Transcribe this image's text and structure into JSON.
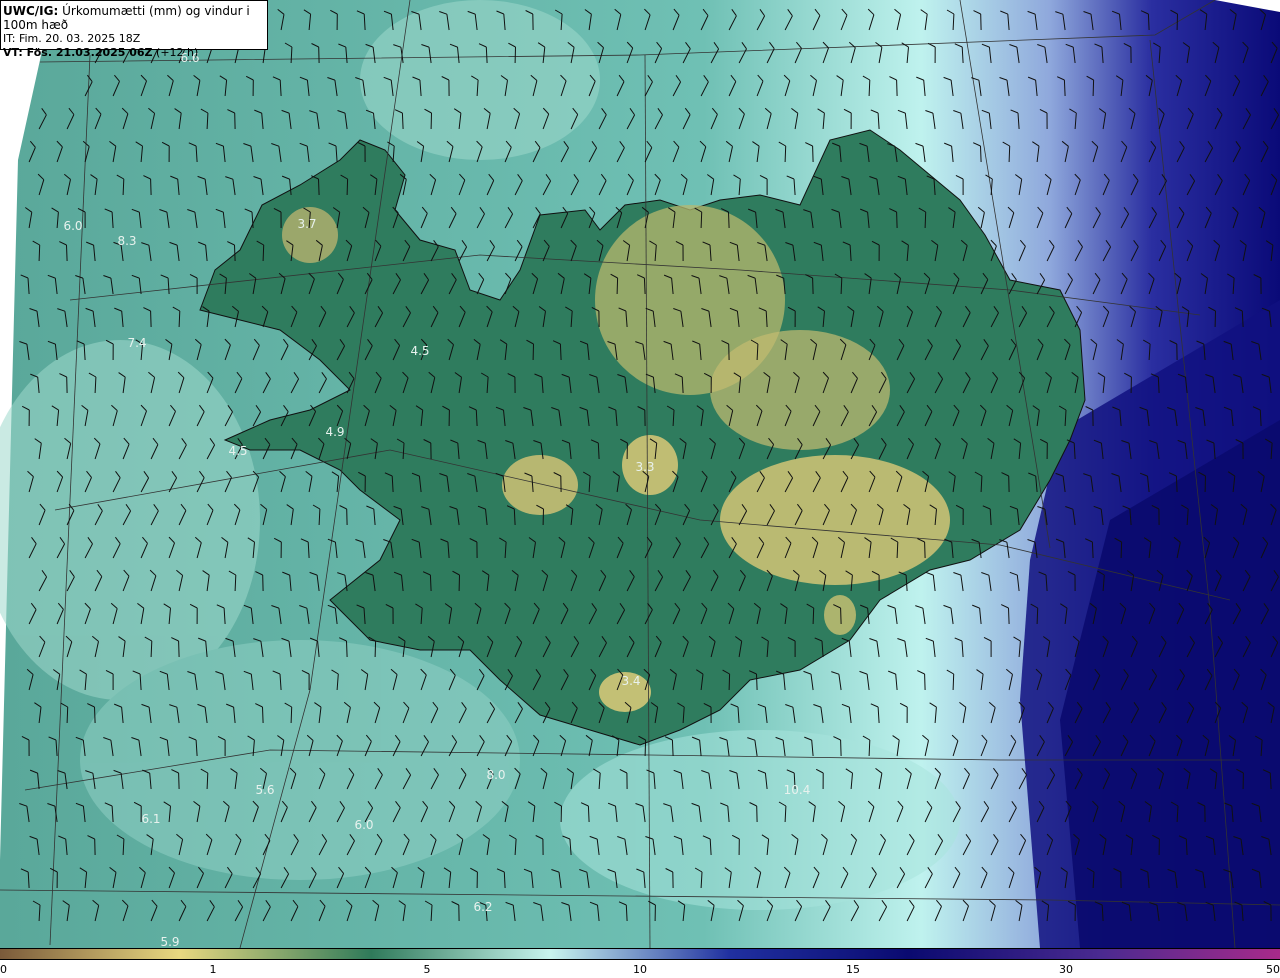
{
  "header": {
    "model": "UWC/IG:",
    "title": "Úrkomumætti (mm) og vindur i 100m hæð",
    "init_time": "IT: Fim. 20. 03. 2025 18Z",
    "valid_prefix": "VT: Fös. 21.03.2025 06Z",
    "valid_suffix": "(+12 h)"
  },
  "map_labels": [
    {
      "text": "6.6"
    },
    {
      "text": "6.0"
    },
    {
      "text": "8.3"
    },
    {
      "text": "3.7"
    },
    {
      "text": "7.4"
    },
    {
      "text": "4.5"
    },
    {
      "text": "4.9"
    },
    {
      "text": "4.5"
    },
    {
      "text": "3.3"
    },
    {
      "text": "3.4"
    },
    {
      "text": "5.6"
    },
    {
      "text": "6.1"
    },
    {
      "text": "6.0"
    },
    {
      "text": "6.2"
    },
    {
      "text": "5.9"
    },
    {
      "text": "10.4"
    },
    {
      "text": "8.0"
    }
  ],
  "colorbar": {
    "ticks": [
      "0",
      "1",
      "5",
      "10",
      "15",
      "30",
      "50"
    ],
    "colors": [
      "#7a5a3a",
      "#e8d880",
      "#2f7a5a",
      "#c8f4ee",
      "#2030a0",
      "#0a0a70",
      "#4a2a90",
      "#a82a8a"
    ]
  },
  "colors": {
    "ocean_base": "#5aa89a",
    "land": "#2c7a5c",
    "highland": "#c8c070",
    "east_moist": "#b8f0ee",
    "east_heavy": "#101078"
  }
}
